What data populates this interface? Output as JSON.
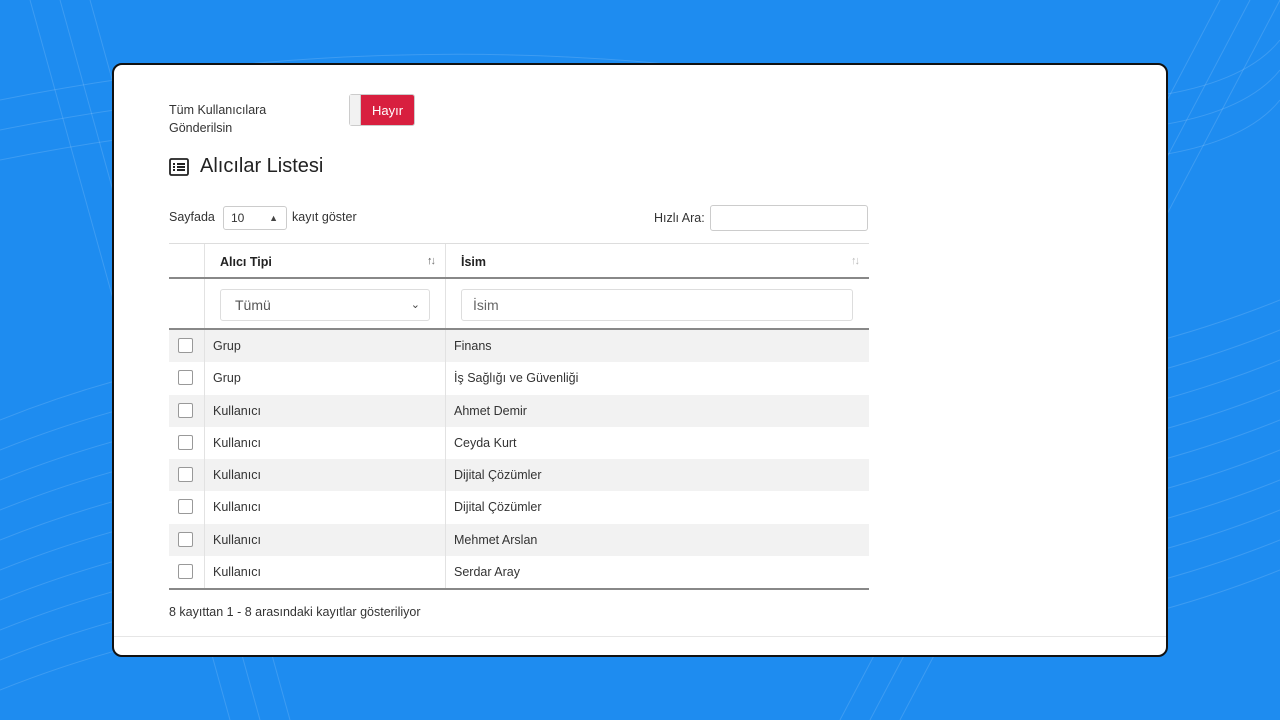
{
  "toggle": {
    "label_line1": "Tüm Kullanıcılara",
    "label_line2": "Gönderilsin",
    "value": "Hayır",
    "active_color": "#d81f3f"
  },
  "section": {
    "title": "Alıcılar Listesi",
    "icon": "list-icon"
  },
  "length_control": {
    "prefix": "Sayfada",
    "selected": "10",
    "suffix": "kayıt göster"
  },
  "search": {
    "label": "Hızlı Ara:",
    "value": ""
  },
  "table": {
    "columns": [
      {
        "label": "Alıcı Tipi",
        "sort": "ascending"
      },
      {
        "label": "İsim",
        "sort": "none"
      }
    ],
    "filters": {
      "type_selected": "Tümü",
      "name_placeholder": "İsim"
    },
    "rows": [
      {
        "type": "Grup",
        "name": "Finans"
      },
      {
        "type": "Grup",
        "name": "İş Sağlığı ve Güvenliği"
      },
      {
        "type": "Kullanıcı",
        "name": "Ahmet Demir"
      },
      {
        "type": "Kullanıcı",
        "name": "Ceyda Kurt"
      },
      {
        "type": "Kullanıcı",
        "name": "Dijital Çözümler"
      },
      {
        "type": "Kullanıcı",
        "name": "Dijital Çözümler"
      },
      {
        "type": "Kullanıcı",
        "name": "Mehmet Arslan"
      },
      {
        "type": "Kullanıcı",
        "name": "Serdar Aray"
      }
    ]
  },
  "info": "8 kayıttan 1 - 8 arasındaki kayıtlar gösteriliyor",
  "background_color": "#1e8cf0"
}
